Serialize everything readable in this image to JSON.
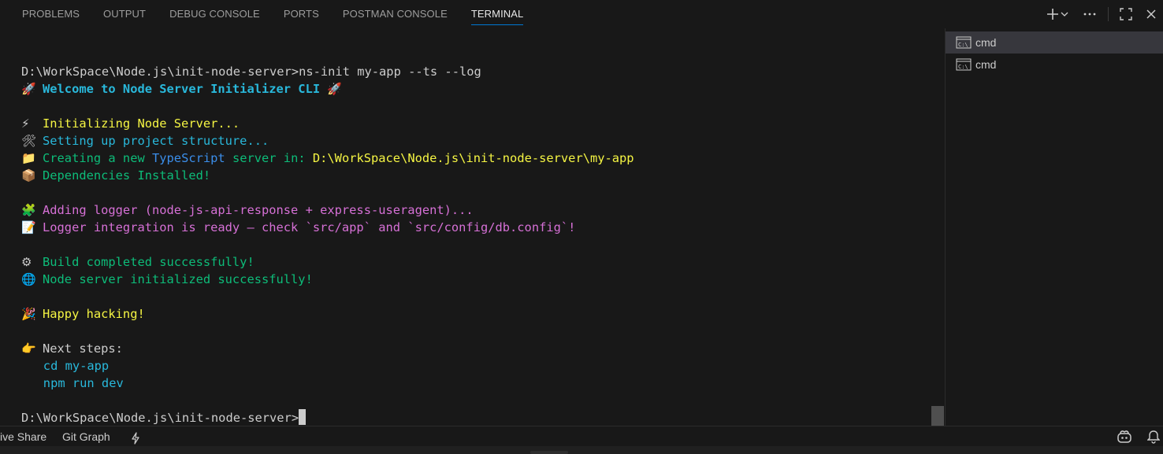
{
  "panel": {
    "tabs": [
      {
        "label": "PROBLEMS",
        "active": false
      },
      {
        "label": "OUTPUT",
        "active": false
      },
      {
        "label": "DEBUG CONSOLE",
        "active": false
      },
      {
        "label": "PORTS",
        "active": false
      },
      {
        "label": "POSTMAN CONSOLE",
        "active": false
      },
      {
        "label": "TERMINAL",
        "active": true
      }
    ],
    "actions": [
      "plus-icon",
      "chevron-down-icon",
      "ellipsis-icon",
      "maximize-icon",
      "close-icon"
    ]
  },
  "terminal": {
    "lines": [
      {
        "emoji": "",
        "segments": [
          {
            "text": "D:\\WorkSpace\\Node.js\\init-node-server>ns-init my-app --ts --log",
            "color": "white"
          }
        ]
      },
      {
        "emoji": "🚀",
        "segments": [
          {
            "text": "Welcome to Node Server Initializer CLI ",
            "color": "cyanb"
          },
          {
            "text": "🚀",
            "color": "emoji"
          }
        ]
      },
      {
        "emoji": "",
        "segments": []
      },
      {
        "emoji": "⚡",
        "segments": [
          {
            "text": "Initializing Node Server...",
            "color": "yellow"
          }
        ]
      },
      {
        "emoji": "🛠",
        "segments": [
          {
            "text": "Setting up project structure...",
            "color": "cyan"
          }
        ]
      },
      {
        "emoji": "📁",
        "segments": [
          {
            "text": "Creating a new ",
            "color": "green2"
          },
          {
            "text": "TypeScript",
            "color": "blue"
          },
          {
            "text": " server in: ",
            "color": "green2"
          },
          {
            "text": "D:\\WorkSpace\\Node.js\\init-node-server\\my-app",
            "color": "yellow"
          }
        ]
      },
      {
        "emoji": "📦",
        "segments": [
          {
            "text": "Dependencies Installed!",
            "color": "green2"
          }
        ]
      },
      {
        "emoji": "",
        "segments": []
      },
      {
        "emoji": "🧩",
        "segments": [
          {
            "text": "Adding logger (node-js-api-response + express-useragent)...",
            "color": "magenta"
          }
        ]
      },
      {
        "emoji": "📝",
        "segments": [
          {
            "text": "Logger integration is ready – check `src/app` and `src/config/db.config`!",
            "color": "magenta"
          }
        ]
      },
      {
        "emoji": "",
        "segments": []
      },
      {
        "emoji": "⚙",
        "segments": [
          {
            "text": "Build completed successfully!",
            "color": "green2"
          }
        ]
      },
      {
        "emoji": "🌐",
        "segments": [
          {
            "text": "Node server initialized successfully!",
            "color": "green2"
          }
        ]
      },
      {
        "emoji": "",
        "segments": []
      },
      {
        "emoji": "🎉",
        "segments": [
          {
            "text": "Happy hacking!",
            "color": "yellow"
          }
        ]
      },
      {
        "emoji": "",
        "segments": []
      },
      {
        "emoji": "👉",
        "segments": [
          {
            "text": "Next steps:",
            "color": "white"
          }
        ]
      },
      {
        "emoji": "",
        "segments": [
          {
            "text": "   cd my-app",
            "color": "cyan"
          }
        ]
      },
      {
        "emoji": "",
        "segments": [
          {
            "text": "   npm run dev",
            "color": "cyan"
          }
        ]
      },
      {
        "emoji": "",
        "segments": []
      },
      {
        "emoji": "",
        "segments": [
          {
            "text": "D:\\WorkSpace\\Node.js\\init-node-server>",
            "color": "white"
          }
        ],
        "cursor": true
      }
    ]
  },
  "terminal_list": {
    "items": [
      {
        "label": "cmd",
        "selected": true
      },
      {
        "label": "cmd",
        "selected": false
      }
    ]
  },
  "statusbar": {
    "live_share": "ive Share",
    "git_graph": "Git Graph",
    "icons": [
      "lightning-icon",
      "copilot-icon",
      "bell-icon"
    ]
  }
}
